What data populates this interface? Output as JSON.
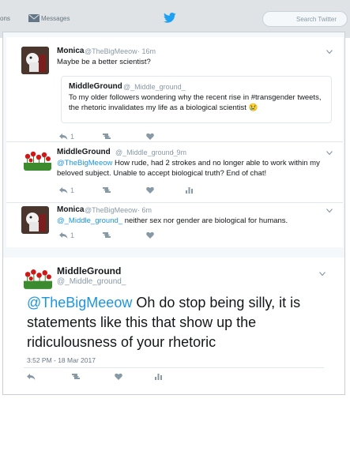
{
  "topbar": {
    "nav_partial": "ons",
    "messages_label": "Messages",
    "search_placeholder": "Search Twitter"
  },
  "tweets": [
    {
      "name": "Monica",
      "handle": "@TheBigMeeow",
      "time": "· 16m",
      "text": "Maybe be a better scientist?",
      "reply_count": "1",
      "quote": {
        "name": "MiddleGround",
        "handle": "@_Middle_ground_",
        "text_line1": "To my older followers wondering why the recent rise in #transgender tweets,",
        "text_line2": "the rhetoric invalidates my life as a biological scientist 😢"
      }
    },
    {
      "name": "MiddleGround",
      "handle": "@_Middle_ground_",
      "time": "· 9m",
      "mention": "@TheBigMeeow",
      "text_line1": " How rude, had 2 strokes and no longer able to work within my",
      "text_line2": "beloved subject. Unable to accept biological truth? End of chat!",
      "reply_count": "1"
    },
    {
      "name": "Monica",
      "handle": "@TheBigMeeow",
      "time": "· 6m",
      "mention": "@_Middle_ground_",
      "text": " neither sex nor gender are biological for humans.",
      "reply_count": "1"
    }
  ],
  "main_tweet": {
    "name": "MiddleGround",
    "handle": "@_Middle_ground_",
    "mention": "@TheBigMeeow",
    "text": " Oh do stop being silly, it is statements like this that show up the ridiculousness of your rhetoric",
    "date": "3:52 PM - 18 Mar 2017"
  }
}
